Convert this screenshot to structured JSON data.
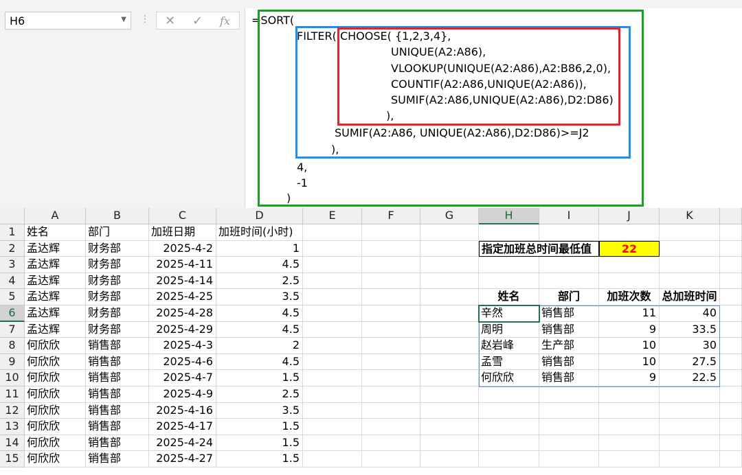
{
  "name_box": {
    "value": "H6"
  },
  "formula_lines": [
    "=SORT(",
    "FILTER( CHOOSE( {1,2,3,4},",
    "UNIQUE(A2:A86),",
    "VLOOKUP(UNIQUE(A2:A86),A2:B86,2,0),",
    "COUNTIF(A2:A86,UNIQUE(A2:A86)),",
    "SUMIF(A2:A86,UNIQUE(A2:A86),D2:D86)",
    "),",
    "SUMIF(A2:A86, UNIQUE(A2:A86),D2:D86)>=J2",
    "),",
    "4,",
    "-1",
    ")"
  ],
  "columns": [
    "A",
    "B",
    "C",
    "D",
    "E",
    "F",
    "G",
    "H",
    "I",
    "J",
    "K"
  ],
  "rows": [
    {
      "n": "1",
      "a": "姓名",
      "b": "部门",
      "c": "加班日期",
      "d": "加班时间(小时)"
    },
    {
      "n": "2",
      "a": "孟达辉",
      "b": "财务部",
      "c": "2025-4-2",
      "d": "1"
    },
    {
      "n": "3",
      "a": "孟达辉",
      "b": "财务部",
      "c": "2025-4-11",
      "d": "4.5"
    },
    {
      "n": "4",
      "a": "孟达辉",
      "b": "财务部",
      "c": "2025-4-14",
      "d": "2.5"
    },
    {
      "n": "5",
      "a": "孟达辉",
      "b": "财务部",
      "c": "2025-4-25",
      "d": "3.5"
    },
    {
      "n": "6",
      "a": "孟达辉",
      "b": "财务部",
      "c": "2025-4-28",
      "d": "4.5"
    },
    {
      "n": "7",
      "a": "孟达辉",
      "b": "财务部",
      "c": "2025-4-29",
      "d": "4.5"
    },
    {
      "n": "8",
      "a": "何欣欣",
      "b": "销售部",
      "c": "2025-4-3",
      "d": "2"
    },
    {
      "n": "9",
      "a": "何欣欣",
      "b": "销售部",
      "c": "2025-4-6",
      "d": "4.5"
    },
    {
      "n": "10",
      "a": "何欣欣",
      "b": "销售部",
      "c": "2025-4-7",
      "d": "1.5"
    },
    {
      "n": "11",
      "a": "何欣欣",
      "b": "销售部",
      "c": "2025-4-9",
      "d": "2.5"
    },
    {
      "n": "12",
      "a": "何欣欣",
      "b": "销售部",
      "c": "2025-4-16",
      "d": "3.5"
    },
    {
      "n": "13",
      "a": "何欣欣",
      "b": "销售部",
      "c": "2025-4-17",
      "d": "1.5"
    },
    {
      "n": "14",
      "a": "何欣欣",
      "b": "销售部",
      "c": "2025-4-24",
      "d": "1.5"
    },
    {
      "n": "15",
      "a": "何欣欣",
      "b": "销售部",
      "c": "2025-4-27",
      "d": "1.5"
    }
  ],
  "criteria": {
    "label": "指定加班总时间最低值",
    "value": "22"
  },
  "result_headers": [
    "姓名",
    "部门",
    "加班次数",
    "总加班时间"
  ],
  "results": [
    {
      "name": "辛然",
      "dept": "销售部",
      "count": "11",
      "hours": "40"
    },
    {
      "name": "周明",
      "dept": "销售部",
      "count": "9",
      "hours": "33.5"
    },
    {
      "name": "赵岩峰",
      "dept": "生产部",
      "count": "10",
      "hours": "30"
    },
    {
      "name": "孟雪",
      "dept": "销售部",
      "count": "10",
      "hours": "27.5"
    },
    {
      "name": "何欣欣",
      "dept": "销售部",
      "count": "9",
      "hours": "22.5"
    }
  ],
  "colors": {
    "accent": "#217346",
    "criteria_fill": "#ffff00",
    "criteria_text": "#ff0000",
    "box_green": "#18a020",
    "box_blue": "#1e90ee",
    "box_red": "#ee2020"
  }
}
